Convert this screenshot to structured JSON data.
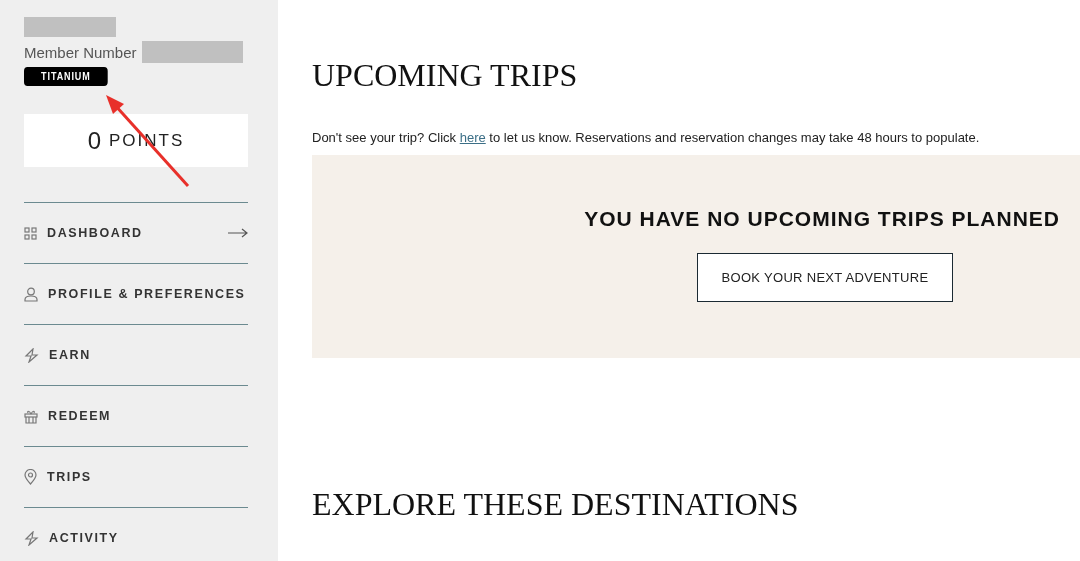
{
  "member": {
    "label": "Member Number",
    "tier": "TITANIUM",
    "points_value": "0",
    "points_label": "POINTS"
  },
  "sidebar": {
    "items": [
      {
        "label": "DASHBOARD",
        "arrow": true
      },
      {
        "label": "PROFILE & PREFERENCES",
        "arrow": false
      },
      {
        "label": "EARN",
        "arrow": false
      },
      {
        "label": "REDEEM",
        "arrow": false
      },
      {
        "label": "TRIPS",
        "arrow": false
      },
      {
        "label": "ACTIVITY",
        "arrow": false
      }
    ]
  },
  "upcoming": {
    "title": "UPCOMING TRIPS",
    "notice_before": "Don't see your trip? Click",
    "notice_link": "here",
    "notice_after": "to let us know. Reservations and reservation changes may take 48 hours to populate.",
    "empty_message": "YOU HAVE NO UPCOMING TRIPS PLANNED",
    "button": "BOOK YOUR NEXT ADVENTURE"
  },
  "explore": {
    "title": "EXPLORE THESE DESTINATIONS"
  }
}
